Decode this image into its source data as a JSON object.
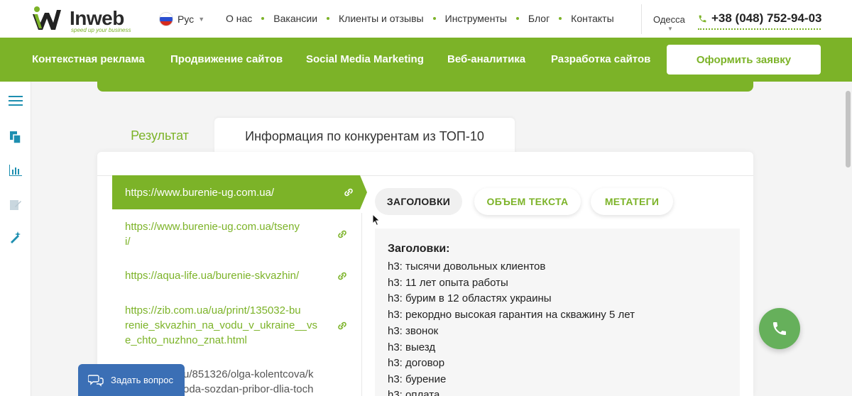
{
  "header": {
    "logo_text": "Inweb",
    "logo_tagline": "speed up your business",
    "language": "Рус",
    "nav": [
      "О нас",
      "Вакансии",
      "Клиенты и отзывы",
      "Инструменты",
      "Блог",
      "Контакты"
    ],
    "city": "Одесса",
    "phone": "+38 (048) 752-94-03"
  },
  "green_nav": {
    "items": [
      "Контекстная реклама",
      "Продвижение сайтов",
      "Social Media Marketing",
      "Веб-аналитика",
      "Разработка сайтов"
    ],
    "cta_label": "Оформить заявку"
  },
  "tabs": [
    {
      "label": "Результат",
      "active": false
    },
    {
      "label": "Информация по конкурентам из ТОП-10",
      "active": true
    }
  ],
  "competitors": [
    {
      "url": "https://www.burenie-ug.com.ua/",
      "active": true
    },
    {
      "url": "https://www.burenie-ug.com.ua/tseny\ni/",
      "active": false
    },
    {
      "url": "https://aqua-life.ua/burenie-skvazhin/",
      "active": false
    },
    {
      "url": "https://zib.com.ua/ua/print/135032-bu\nrenie_skvazhin_na_vodu_v_ukraine__vs\ne_chto_nuzhno_znat.html",
      "active": false
    },
    {
      "url": "u/851326/olga-kolentcova/k\noda-sozdan-pribor-dlia-toch",
      "active": false
    }
  ],
  "panel": {
    "pills": [
      "ЗАГОЛОВКИ",
      "ОБЪЕМ ТЕКСТА",
      "МЕТАТЕГИ"
    ],
    "active_pill": "ЗАГОЛОВКИ",
    "content_title": "Заголовки:",
    "headings": [
      "h3: тысячи довольных клиентов",
      "h3: 11 лет опыта работы",
      "h3: бурим в 12 областях украины",
      "h3: рекордно высокая гарантия на скважину 5 лет",
      "h3: звонок",
      "h3: выезд",
      "h3: договор",
      "h3: бурение",
      "h3: оплата"
    ]
  },
  "floating": {
    "ask_label": "Задать вопрос"
  },
  "colors": {
    "brand_green": "#7cb328",
    "call_green": "#66b05b",
    "ask_blue": "#3b6fb5"
  }
}
